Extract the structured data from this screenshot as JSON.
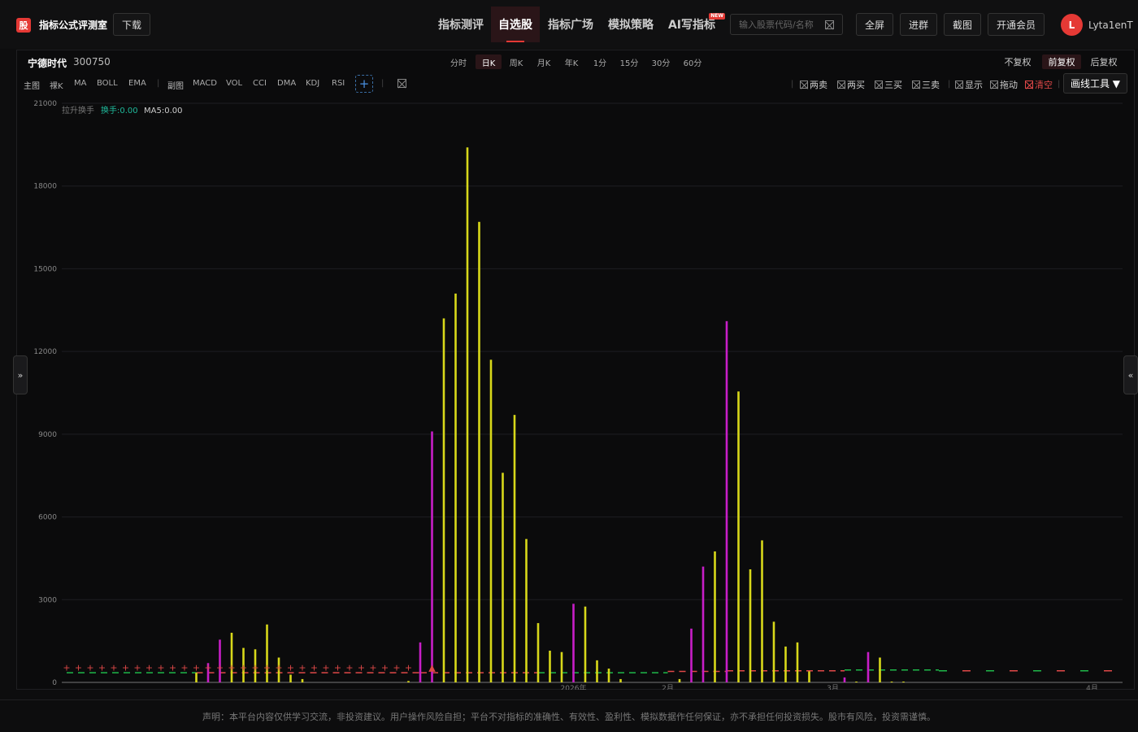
{
  "header": {
    "logo_text": "股",
    "app_title": "指标公式评测室",
    "download_label": "下载",
    "nav_tabs": [
      "指标测评",
      "自选股",
      "指标广场",
      "模拟策略",
      "AI写指标"
    ],
    "new_badge": "NEW",
    "search_placeholder": "输入股票代码/名称",
    "fullscreen_label": "全屏",
    "join_group_label": "进群",
    "screenshot_label": "截图",
    "vip_label": "开通会员",
    "avatar_letter": "L",
    "username": "Lyta1enT"
  },
  "stock": {
    "name": "宁德时代",
    "code": "300750"
  },
  "periods": [
    "分时",
    "日K",
    "周K",
    "月K",
    "年K",
    "1分",
    "15分",
    "30分",
    "60分"
  ],
  "adjust": [
    "不复权",
    "前复权",
    "后复权"
  ],
  "indicators": {
    "main_label": "主图",
    "main": [
      "裸K",
      "MA",
      "BOLL",
      "EMA"
    ],
    "sub_label": "副图",
    "sub": [
      "MACD",
      "VOL",
      "CCI",
      "DMA",
      "KDJ",
      "RSI"
    ],
    "add_symbol": "+"
  },
  "options": [
    "两卖",
    "两买",
    "三买",
    "三卖",
    "显示",
    "拖动",
    "清空"
  ],
  "draw_tools_label": "画线工具 ▼",
  "left_toggle": "»",
  "right_toggle": "«",
  "legend": {
    "name": "拉升换手",
    "huanshou": "换手:0.00",
    "ma5": "MA5:0.00"
  },
  "footer_text": "声明：本平台内容仅供学习交流，非投资建议。用户操作风险自担；平台不对指标的准确性、有效性、盈利性、模拟数据作任何保证，亦不承担任何投资损失。股市有风险，投资需谨慎。",
  "colors": {
    "accent": "#e53935",
    "yellow_bar": "#d8d81a",
    "magenta_bar": "#c81ec8",
    "green_dash": "#1fb84a",
    "red_dash": "#e04848"
  },
  "chart_data": {
    "type": "bar",
    "ylim": [
      0,
      21000
    ],
    "yticks": [
      0,
      3000,
      6000,
      9000,
      12000,
      15000,
      18000,
      21000
    ],
    "xticks": [
      {
        "x": 43,
        "label": "2026年"
      },
      {
        "x": 51,
        "label": "2月"
      },
      {
        "x": 65,
        "label": "3月"
      },
      {
        "x": 87,
        "label": "4月"
      }
    ],
    "x_count": 90,
    "bars": [
      {
        "x": 11,
        "value": 350,
        "color": "yellow"
      },
      {
        "x": 12,
        "value": 700,
        "color": "magenta"
      },
      {
        "x": 13,
        "value": 1550,
        "color": "magenta"
      },
      {
        "x": 14,
        "value": 1800,
        "color": "yellow"
      },
      {
        "x": 15,
        "value": 1250,
        "color": "yellow"
      },
      {
        "x": 16,
        "value": 1200,
        "color": "yellow"
      },
      {
        "x": 17,
        "value": 2100,
        "color": "yellow"
      },
      {
        "x": 18,
        "value": 900,
        "color": "yellow"
      },
      {
        "x": 19,
        "value": 280,
        "color": "yellow"
      },
      {
        "x": 20,
        "value": 120,
        "color": "yellow"
      },
      {
        "x": 29,
        "value": 50,
        "color": "yellow"
      },
      {
        "x": 30,
        "value": 1450,
        "color": "magenta"
      },
      {
        "x": 31,
        "value": 9100,
        "color": "magenta"
      },
      {
        "x": 32,
        "value": 13200,
        "color": "yellow"
      },
      {
        "x": 33,
        "value": 14100,
        "color": "yellow"
      },
      {
        "x": 34,
        "value": 19400,
        "color": "yellow"
      },
      {
        "x": 35,
        "value": 16700,
        "color": "yellow"
      },
      {
        "x": 36,
        "value": 11700,
        "color": "yellow"
      },
      {
        "x": 37,
        "value": 7600,
        "color": "yellow"
      },
      {
        "x": 38,
        "value": 9700,
        "color": "yellow"
      },
      {
        "x": 39,
        "value": 5200,
        "color": "yellow"
      },
      {
        "x": 40,
        "value": 2150,
        "color": "yellow"
      },
      {
        "x": 41,
        "value": 1150,
        "color": "yellow"
      },
      {
        "x": 42,
        "value": 1100,
        "color": "yellow"
      },
      {
        "x": 43,
        "value": 2850,
        "color": "magenta"
      },
      {
        "x": 44,
        "value": 2750,
        "color": "yellow"
      },
      {
        "x": 45,
        "value": 800,
        "color": "yellow"
      },
      {
        "x": 46,
        "value": 500,
        "color": "yellow"
      },
      {
        "x": 47,
        "value": 120,
        "color": "yellow"
      },
      {
        "x": 52,
        "value": 120,
        "color": "yellow"
      },
      {
        "x": 53,
        "value": 1950,
        "color": "magenta"
      },
      {
        "x": 54,
        "value": 4200,
        "color": "magenta"
      },
      {
        "x": 55,
        "value": 4750,
        "color": "yellow"
      },
      {
        "x": 56,
        "value": 13100,
        "color": "magenta"
      },
      {
        "x": 57,
        "value": 10550,
        "color": "yellow"
      },
      {
        "x": 58,
        "value": 4100,
        "color": "yellow"
      },
      {
        "x": 59,
        "value": 5150,
        "color": "yellow"
      },
      {
        "x": 60,
        "value": 2200,
        "color": "yellow"
      },
      {
        "x": 61,
        "value": 1300,
        "color": "yellow"
      },
      {
        "x": 62,
        "value": 1450,
        "color": "yellow"
      },
      {
        "x": 63,
        "value": 400,
        "color": "yellow"
      },
      {
        "x": 66,
        "value": 180,
        "color": "magenta"
      },
      {
        "x": 67,
        "value": 30,
        "color": "yellow"
      },
      {
        "x": 68,
        "value": 1100,
        "color": "magenta"
      },
      {
        "x": 69,
        "value": 900,
        "color": "yellow"
      },
      {
        "x": 70,
        "value": 30,
        "color": "yellow"
      },
      {
        "x": 71,
        "value": 30,
        "color": "yellow"
      }
    ],
    "ma_segments": [
      {
        "from": 0,
        "to": 11,
        "value": 350,
        "color": "green"
      },
      {
        "from": 11,
        "to": 30,
        "value": 350,
        "color": "red"
      },
      {
        "from": 30,
        "to": 40,
        "value": 350,
        "color": "red"
      },
      {
        "from": 40,
        "to": 51,
        "value": 350,
        "color": "green"
      },
      {
        "from": 51,
        "to": 56,
        "value": 400,
        "color": "red"
      },
      {
        "from": 56,
        "to": 66,
        "value": 420,
        "color": "red"
      },
      {
        "from": 66,
        "to": 74,
        "value": 450,
        "color": "green"
      },
      {
        "from": 74,
        "to": 90,
        "value": 420,
        "color": "mixed"
      }
    ],
    "markers": [
      {
        "from": 0,
        "to": 30,
        "value": 550,
        "symbol": "+"
      },
      {
        "x": 31,
        "value": 550,
        "symbol": "▲"
      }
    ]
  }
}
